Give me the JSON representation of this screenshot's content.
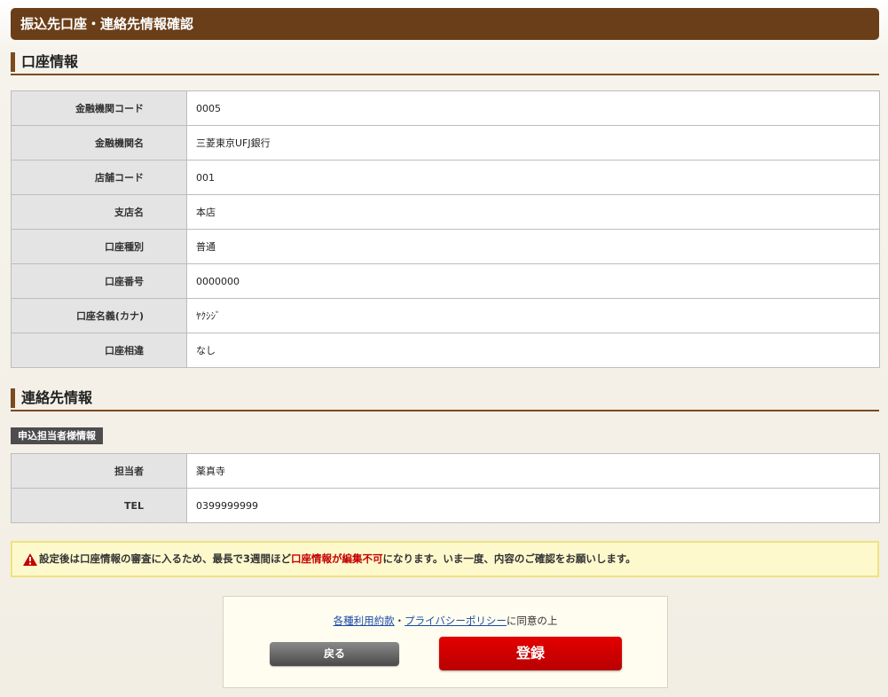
{
  "page_title": "振込先口座・連絡先情報確認",
  "account_section": {
    "heading": "口座情報",
    "rows": [
      {
        "label": "金融機関コード",
        "value": "0005"
      },
      {
        "label": "金融機関名",
        "value": "三菱東京UFJ銀行"
      },
      {
        "label": "店舗コード",
        "value": "001"
      },
      {
        "label": "支店名",
        "value": "本店"
      },
      {
        "label": "口座種別",
        "value": "普通"
      },
      {
        "label": "口座番号",
        "value": "0000000"
      },
      {
        "label": "口座名義(カナ)",
        "value": "ﾔｸｼｼﾞ"
      },
      {
        "label": "口座相違",
        "value": "なし"
      }
    ]
  },
  "contact_section": {
    "heading": "連絡先情報",
    "sub_label": "申込担当者様情報",
    "rows": [
      {
        "label": "担当者",
        "value": "薬真寺"
      },
      {
        "label": "TEL",
        "value": "0399999999"
      }
    ]
  },
  "warning": {
    "icon": "warning-icon",
    "text_before": "設定後は口座情報の審査に入るため、最長で3週間ほど",
    "text_highlight": "口座情報が編集不可",
    "text_after": "になります。いま一度、内容のご確認をお願いします。",
    "highlight_color": "#c40000"
  },
  "agreement": {
    "terms_link": "各種利用約款",
    "separator": "・",
    "privacy_link": "プライバシーポリシー",
    "suffix": "に同意の上"
  },
  "buttons": {
    "back_label": "戻る",
    "submit_label": "登録"
  },
  "colors": {
    "brand_brown": "#6a3e18",
    "submit_red": "#d40000",
    "link_blue": "#1a4aa8"
  }
}
